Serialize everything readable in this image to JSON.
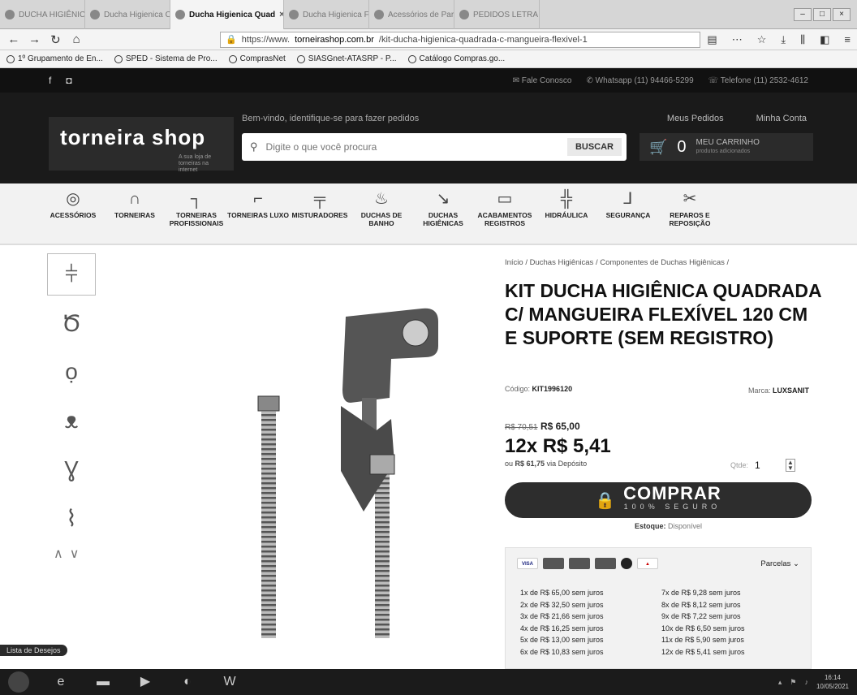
{
  "browser": {
    "tabs": [
      {
        "label": "DUCHA HIGIÊNICA",
        "active": false
      },
      {
        "label": "Ducha Higienica Cl",
        "active": false
      },
      {
        "label": "Ducha Higienica Quad",
        "active": true
      },
      {
        "label": "Ducha Higienica Fle",
        "active": false
      },
      {
        "label": "Acessórios de Parede",
        "active": false
      },
      {
        "label": "PEDIDOS LETRA - Pesq",
        "active": false
      }
    ],
    "url_prefix": "https://www.",
    "url_domain": "torneirashop.com.br",
    "url_path": "/kit-ducha-higienica-quadrada-c-mangueira-flexivel-1",
    "bookmarks": [
      "1º Grupamento de En...",
      "SPED - Sistema de Pro...",
      "ComprasNet",
      "SIASGnet-ATASRP - P...",
      "Catálogo Compras.go..."
    ]
  },
  "site": {
    "contacts": [
      "Fale Conosco",
      "Whatsapp (11) 94466-5299",
      "Telefone (11) 2532-4612"
    ],
    "logo_main": "torneira",
    "logo_shop": "shop",
    "logo_tagline": "A sua loja de torneiras na internet",
    "welcome": "Bem-vindo, identifique-se para fazer pedidos",
    "search_placeholder": "Digite o que você procura",
    "search_button": "BUSCAR",
    "meus_pedidos": "Meus Pedidos",
    "minha_conta": "Minha Conta",
    "cart_count": "0",
    "cart_label": "MEU CARRINHO",
    "cart_sub": "produtos adicionados"
  },
  "categories": [
    {
      "label": "ACESSÓRIOS",
      "icon": "accessory-icon"
    },
    {
      "label": "TORNEIRAS",
      "icon": "faucet-icon"
    },
    {
      "label": "TORNEIRAS PROFISSIONAIS",
      "icon": "pro-faucet-icon"
    },
    {
      "label": "TORNEIRAS LUXO",
      "icon": "luxury-faucet-icon"
    },
    {
      "label": "MISTURADORES",
      "icon": "mixer-icon"
    },
    {
      "label": "DUCHAS DE BANHO",
      "icon": "shower-icon"
    },
    {
      "label": "DUCHAS HIGIÊNICAS",
      "icon": "hygienic-shower-icon"
    },
    {
      "label": "ACABAMENTOS REGISTROS",
      "icon": "valve-icon"
    },
    {
      "label": "HIDRÁULICA",
      "icon": "pipe-icon"
    },
    {
      "label": "SEGURANÇA",
      "icon": "safety-icon"
    },
    {
      "label": "REPAROS E REPOSIÇÃO",
      "icon": "tools-icon"
    }
  ],
  "product": {
    "breadcrumb": "Início / Duchas Higiênicas / Componentes de Duchas Higiênicas /",
    "title": "KIT DUCHA HIGIÊNICA QUADRADA C/ MANGUEIRA FLEXÍVEL 120 CM E SUPORTE (SEM REGISTRO)",
    "codigo_label": "Código:",
    "codigo": "KIT1996120",
    "marca_label": "Marca:",
    "marca": "LUXSANIT",
    "old_price": "R$ 70,51",
    "price": "R$ 65,00",
    "installment_big": "12x R$ 5,41",
    "deposit_prefix": "ou",
    "deposit_value": "R$ 61,75",
    "deposit_suffix": "via Depósito",
    "qty_label": "Qtde:",
    "qty_value": "1",
    "buy_label": "COMPRAR",
    "buy_sub": "100% SEGURO",
    "stock_label": "Estoque:",
    "stock_value": "Disponível",
    "parcelas_label": "Parcelas",
    "installments_col1": [
      "1x de R$ 65,00 sem juros",
      "2x de R$ 32,50 sem juros",
      "3x de R$ 21,66 sem juros",
      "4x de R$ 16,25 sem juros",
      "5x de R$ 13,00 sem juros",
      "6x de R$ 10,83 sem juros"
    ],
    "installments_col2": [
      "7x de R$ 9,28 sem juros",
      "8x de R$ 8,12 sem juros",
      "9x de R$ 7,22 sem juros",
      "10x de R$ 6,50 sem juros",
      "11x de R$ 5,90 sem juros",
      "12x de R$ 5,41 sem juros"
    ]
  },
  "wishlist_label": "Lista de Desejos",
  "clock": {
    "time": "16:14",
    "date": "10/05/2021"
  }
}
